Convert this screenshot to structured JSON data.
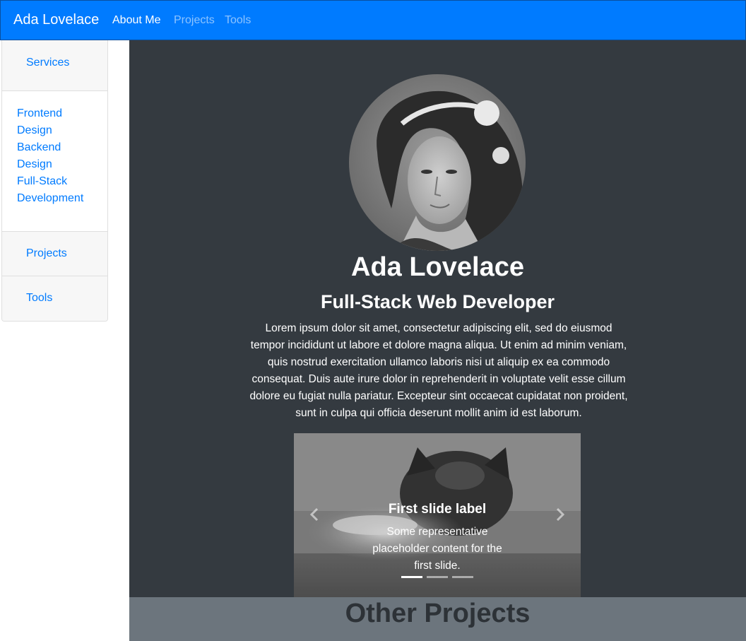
{
  "navbar": {
    "brand": "Ada Lovelace",
    "links": [
      {
        "label": "About Me",
        "active": true
      },
      {
        "label": "Projects",
        "active": false
      },
      {
        "label": "Tools",
        "active": false
      }
    ]
  },
  "sidebar": {
    "services": "Services",
    "service_items": [
      "Frontend",
      "Design",
      "Backend",
      "Design",
      "Full-Stack",
      "Development"
    ],
    "projects": "Projects",
    "tools": "Tools"
  },
  "profile": {
    "name": "Ada Lovelace",
    "role": "Full-Stack Web Developer",
    "bio": "Lorem ipsum dolor sit amet, consectetur adipiscing elit, sed do eiusmod tempor incididunt ut labore et dolore magna aliqua. Ut enim ad minim veniam, quis nostrud exercitation ullamco laboris nisi ut aliquip ex ea commodo consequat. Duis aute irure dolor in reprehenderit in voluptate velit esse cillum dolore eu fugiat nulla pariatur. Excepteur sint occaecat cupidatat non proident, sunt in culpa qui officia deserunt mollit anim id est laborum."
  },
  "carousel": {
    "slide_label": "First slide label",
    "slide_text": "Some representative placeholder content for the first slide.",
    "active_index": 0,
    "slide_count": 3
  },
  "other_projects": {
    "heading": "Other Projects"
  },
  "colors": {
    "primary": "#007bff",
    "main_bg": "#343a40",
    "section_bg": "#6c757d"
  },
  "icons": [
    "chevron-left-icon",
    "chevron-right-icon"
  ]
}
